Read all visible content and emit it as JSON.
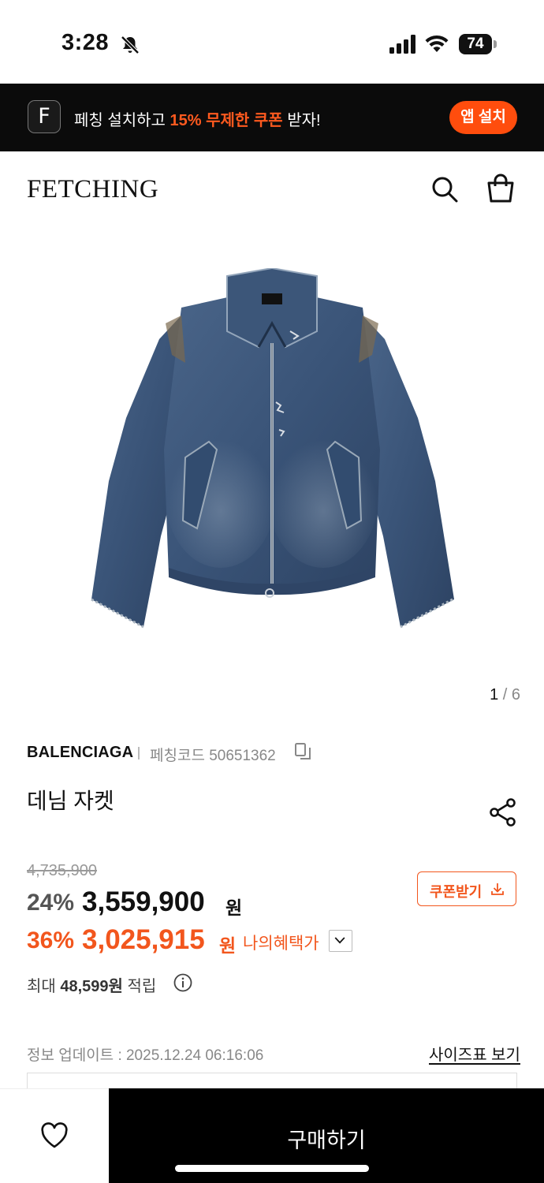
{
  "status_bar": {
    "time": "3:28",
    "battery": "74"
  },
  "promo": {
    "app_letter": "F",
    "text_before": "페칭 설치하고 ",
    "highlight": "15% 무제한 쿠폰",
    "text_after": " 받자!",
    "install_label": "앱 설치"
  },
  "header": {
    "logo": "FETCHING"
  },
  "gallery": {
    "current": "1",
    "separator": " / ",
    "total": "6"
  },
  "product": {
    "brand": "BALENCIAGA",
    "code_label": "페칭코드",
    "code": "50651362",
    "name": "데님 자켓"
  },
  "pricing": {
    "original": "4,735,900",
    "discount_1": "24%",
    "price_1": "3,559,900",
    "currency": "원",
    "discount_2": "36%",
    "price_2": "3,025,915",
    "benefit_label": "나의혜택가",
    "coupon_label": "쿠폰받기"
  },
  "points": {
    "prefix": "최대 ",
    "amount": "48,599원",
    "suffix": " 적립"
  },
  "update": {
    "label": "정보 업데이트 : 2025.12.24 06:16:06"
  },
  "size_chart": {
    "label": "사이즈표 보기"
  },
  "bottom": {
    "buy_label": "구매하기"
  },
  "colors": {
    "accent": "#f2561d",
    "banner_bg": "#0b0b0b",
    "buy_bg": "#000000"
  }
}
